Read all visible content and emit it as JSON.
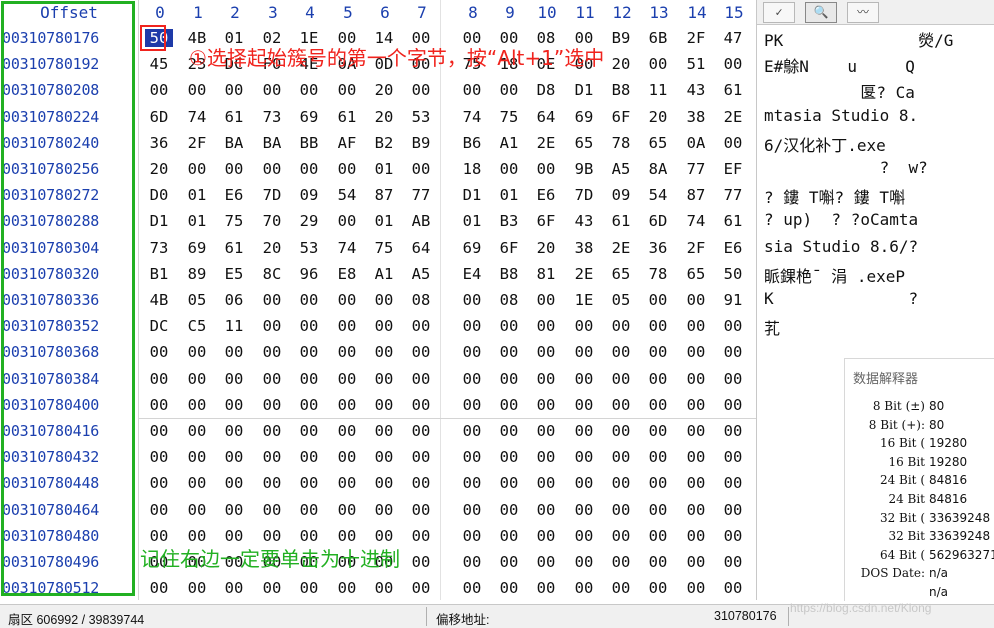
{
  "header": {
    "offset_title": "Offset",
    "columns": [
      "0",
      "1",
      "2",
      "3",
      "4",
      "5",
      "6",
      "7",
      "8",
      "9",
      "10",
      "11",
      "12",
      "13",
      "14",
      "15"
    ]
  },
  "rows": [
    {
      "offset": "00310780176",
      "hex": [
        "50",
        "4B",
        "01",
        "02",
        "1E",
        "00",
        "14",
        "00",
        "00",
        "00",
        "08",
        "00",
        "B9",
        "6B",
        "2F",
        "47"
      ],
      "text": "PK              熒/G"
    },
    {
      "offset": "00310780192",
      "hex": [
        "45",
        "23",
        "DC",
        "F0",
        "4E",
        "0A",
        "0D",
        "00",
        "75",
        "18",
        "0E",
        "00",
        "20",
        "00",
        "51",
        "00"
      ],
      "text": "E#鵌N    u     Q"
    },
    {
      "offset": "00310780208",
      "hex": [
        "00",
        "00",
        "00",
        "00",
        "00",
        "00",
        "20",
        "00",
        "00",
        "00",
        "D8",
        "D1",
        "B8",
        "11",
        "43",
        "61"
      ],
      "text": "          匽? Ca"
    },
    {
      "offset": "00310780224",
      "hex": [
        "6D",
        "74",
        "61",
        "73",
        "69",
        "61",
        "20",
        "53",
        "74",
        "75",
        "64",
        "69",
        "6F",
        "20",
        "38",
        "2E"
      ],
      "text": "mtasia Studio 8."
    },
    {
      "offset": "00310780240",
      "hex": [
        "36",
        "2F",
        "BA",
        "BA",
        "BB",
        "AF",
        "B2",
        "B9",
        "B6",
        "A1",
        "2E",
        "65",
        "78",
        "65",
        "0A",
        "00"
      ],
      "text": "6/汉化补丁.exe"
    },
    {
      "offset": "00310780256",
      "hex": [
        "20",
        "00",
        "00",
        "00",
        "00",
        "00",
        "01",
        "00",
        "18",
        "00",
        "00",
        "9B",
        "A5",
        "8A",
        "77",
        "EF"
      ],
      "text": "            ?  w?"
    },
    {
      "offset": "00310780272",
      "hex": [
        "D0",
        "01",
        "E6",
        "7D",
        "09",
        "54",
        "87",
        "77",
        "D1",
        "01",
        "E6",
        "7D",
        "09",
        "54",
        "87",
        "77"
      ],
      "text": "? 鏤 T嘝? 鏤 T嘝"
    },
    {
      "offset": "00310780288",
      "hex": [
        "D1",
        "01",
        "75",
        "70",
        "29",
        "00",
        "01",
        "AB",
        "01",
        "B3",
        "6F",
        "43",
        "61",
        "6D",
        "74",
        "61"
      ],
      "text": "? up)  ? ?oCamta"
    },
    {
      "offset": "00310780304",
      "hex": [
        "73",
        "69",
        "61",
        "20",
        "53",
        "74",
        "75",
        "64",
        "69",
        "6F",
        "20",
        "38",
        "2E",
        "36",
        "2F",
        "E6"
      ],
      "text": "sia Studio 8.6/?"
    },
    {
      "offset": "00310780320",
      "hex": [
        "B1",
        "89",
        "E5",
        "8C",
        "96",
        "E8",
        "A1",
        "A5",
        "E4",
        "B8",
        "81",
        "2E",
        "65",
        "78",
        "65",
        "50"
      ],
      "text": "眽錁栬ˉ 涓 .exeP"
    },
    {
      "offset": "00310780336",
      "hex": [
        "4B",
        "05",
        "06",
        "00",
        "00",
        "00",
        "00",
        "08",
        "00",
        "08",
        "00",
        "1E",
        "05",
        "00",
        "00",
        "91"
      ],
      "text": "K              ?"
    },
    {
      "offset": "00310780352",
      "hex": [
        "DC",
        "C5",
        "11",
        "00",
        "00",
        "00",
        "00",
        "00",
        "00",
        "00",
        "00",
        "00",
        "00",
        "00",
        "00",
        "00"
      ],
      "text": "芤"
    },
    {
      "offset": "00310780368",
      "hex": [
        "00",
        "00",
        "00",
        "00",
        "00",
        "00",
        "00",
        "00",
        "00",
        "00",
        "00",
        "00",
        "00",
        "00",
        "00",
        "00"
      ],
      "text": ""
    },
    {
      "offset": "00310780384",
      "hex": [
        "00",
        "00",
        "00",
        "00",
        "00",
        "00",
        "00",
        "00",
        "00",
        "00",
        "00",
        "00",
        "00",
        "00",
        "00",
        "00"
      ],
      "text": ""
    },
    {
      "offset": "00310780400",
      "hex": [
        "00",
        "00",
        "00",
        "00",
        "00",
        "00",
        "00",
        "00",
        "00",
        "00",
        "00",
        "00",
        "00",
        "00",
        "00",
        "00"
      ],
      "text": ""
    },
    {
      "offset": "00310780416",
      "hex": [
        "00",
        "00",
        "00",
        "00",
        "00",
        "00",
        "00",
        "00",
        "00",
        "00",
        "00",
        "00",
        "00",
        "00",
        "00",
        "00"
      ],
      "text": ""
    },
    {
      "offset": "00310780432",
      "hex": [
        "00",
        "00",
        "00",
        "00",
        "00",
        "00",
        "00",
        "00",
        "00",
        "00",
        "00",
        "00",
        "00",
        "00",
        "00",
        "00"
      ],
      "text": ""
    },
    {
      "offset": "00310780448",
      "hex": [
        "00",
        "00",
        "00",
        "00",
        "00",
        "00",
        "00",
        "00",
        "00",
        "00",
        "00",
        "00",
        "00",
        "00",
        "00",
        "00"
      ],
      "text": ""
    },
    {
      "offset": "00310780464",
      "hex": [
        "00",
        "00",
        "00",
        "00",
        "00",
        "00",
        "00",
        "00",
        "00",
        "00",
        "00",
        "00",
        "00",
        "00",
        "00",
        "00"
      ],
      "text": ""
    },
    {
      "offset": "00310780480",
      "hex": [
        "00",
        "00",
        "00",
        "00",
        "00",
        "00",
        "00",
        "00",
        "00",
        "00",
        "00",
        "00",
        "00",
        "00",
        "00",
        "00"
      ],
      "text": ""
    },
    {
      "offset": "00310780496",
      "hex": [
        "00",
        "00",
        "00",
        "00",
        "00",
        "00",
        "00",
        "00",
        "00",
        "00",
        "00",
        "00",
        "00",
        "00",
        "00",
        "00"
      ],
      "text": ""
    },
    {
      "offset": "00310780512",
      "hex": [
        "00",
        "00",
        "00",
        "00",
        "00",
        "00",
        "00",
        "00",
        "00",
        "00",
        "00",
        "00",
        "00",
        "00",
        "00",
        "00"
      ],
      "text": ""
    }
  ],
  "selected_cell": {
    "row": 0,
    "col": 0
  },
  "text_panel": {
    "toolbar": [
      {
        "icon": "check-icon",
        "glyph": "✓"
      },
      {
        "icon": "search-icon",
        "glyph": "🔍"
      },
      {
        "icon": "wave-icon",
        "glyph": "〰"
      }
    ]
  },
  "interpreter": {
    "title": "数据解释器",
    "rows": [
      {
        "label": "8 Bit (±)",
        "value": "80"
      },
      {
        "label": "8 Bit (+):",
        "value": "80"
      },
      {
        "label": "16 Bit (",
        "value": "19280"
      },
      {
        "label": "16 Bit",
        "value": "19280"
      },
      {
        "label": "24 Bit (",
        "value": "84816"
      },
      {
        "label": "24 Bit",
        "value": "84816"
      },
      {
        "label": "32 Bit (",
        "value": "33639248"
      },
      {
        "label": "32 Bit",
        "value": "33639248"
      },
      {
        "label": "64 Bit (",
        "value": "562963271"
      },
      {
        "label": "DOS Date:",
        "value": "n/a"
      },
      {
        "label": "",
        "value": "n/a"
      }
    ]
  },
  "statusbar": {
    "sector": "扇区 606992 / 39839744",
    "offset_label": "偏移地址:",
    "offset_value": "310780176"
  },
  "annotations": {
    "red": "①选择起始簇号的第一个字节，按“Alt+1”选中",
    "green": "记住右边一定要单击为十进制"
  },
  "watermark": "https://blog.csdn.net/Klong",
  "colors": {
    "offset_blue": "#1b3fae",
    "select_blue": "#1e3aa8",
    "annot_red": "#f0231d",
    "annot_green": "#22b022"
  }
}
